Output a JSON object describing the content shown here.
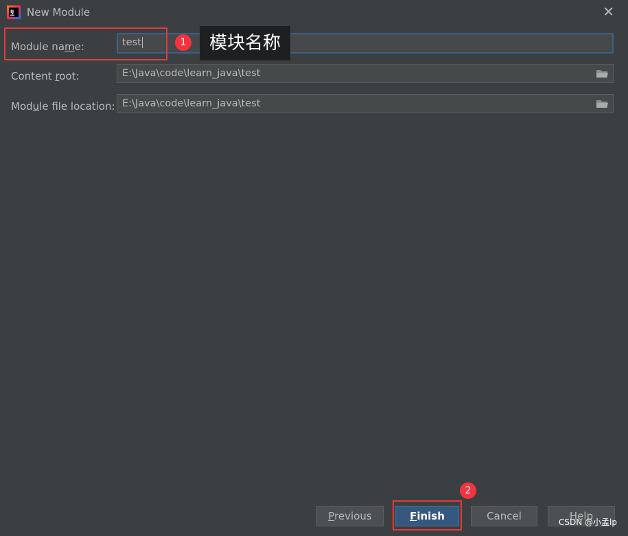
{
  "window": {
    "title": "New Module",
    "close_glyph": "✕"
  },
  "form": {
    "module_name": {
      "label_pre": "Module na",
      "label_u": "m",
      "label_post": "e:",
      "value": "test"
    },
    "content_root": {
      "label_pre": "Content ",
      "label_u": "r",
      "label_post": "oot:",
      "value": "E:\\Java\\code\\learn_java\\test"
    },
    "module_file_location": {
      "label_pre": "Mod",
      "label_u": "u",
      "label_post": "le file location:",
      "value": "E:\\Java\\code\\learn_java\\test"
    }
  },
  "annotations": {
    "badge1": "1",
    "badge2": "2",
    "tooltip": "模块名称",
    "highlight_color": "#e03c3c"
  },
  "buttons": {
    "previous": {
      "u": "P",
      "rest": "revious"
    },
    "finish": {
      "u": "F",
      "rest": "inish"
    },
    "cancel": "Cancel",
    "help": "Help"
  },
  "watermark": "CSDN @小孟lp",
  "colors": {
    "background": "#3c3f41",
    "field_bg": "#45494a",
    "focus_border": "#3d6185",
    "primary_button": "#365880",
    "badge": "#f5333f"
  },
  "icons": [
    "intellij-app-icon",
    "close-icon",
    "folder-icon"
  ]
}
